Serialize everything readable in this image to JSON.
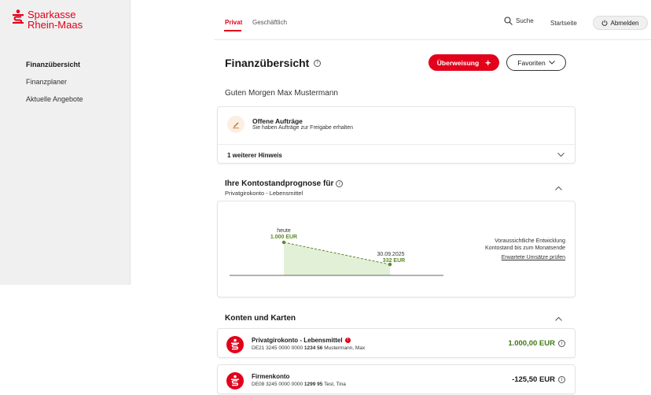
{
  "brand": {
    "name_line1": "Sparkasse",
    "name_line2": "Rhein-Maas",
    "color": "#e2001a"
  },
  "sidebar": {
    "items": [
      {
        "label": "Finanzübersicht",
        "active": true
      },
      {
        "label": "Finanzplaner",
        "active": false
      },
      {
        "label": "Aktuelle Angebote",
        "active": false
      }
    ]
  },
  "topbar": {
    "segments": [
      "Privat",
      "Geschäftlich"
    ],
    "search_label": "Suche",
    "home_label": "Startseite",
    "logout_label": "Abmelden"
  },
  "page": {
    "title": "Finanzübersicht",
    "transfer_label": "Überweisung",
    "favorites_label": "Favoriten",
    "greeting": "Guten Morgen Max Mustermann"
  },
  "orders": {
    "title": "Offene Aufträge",
    "subtitle": "Sie haben Aufträge zur Freigabe erhalten",
    "hint": "1 weiterer Hinweis"
  },
  "forecast": {
    "title": "Ihre Kontostandprognose für",
    "account": "Privatgirokonto - Lebensmittel",
    "start_label": "heute",
    "start_value": "1.000 EUR",
    "end_label": "30.09.2025",
    "end_value": "332 EUR",
    "desc_line1": "Voraussichtliche Entwicklung",
    "desc_line2": "Kontostand bis zum Monatsende",
    "link": "Erwartete Umsätze prüfen",
    "line_color": "#5a8a2a",
    "fill_color": "#e3f0d8"
  },
  "chart_data": {
    "type": "area",
    "x": [
      "heute",
      "30.09.2025"
    ],
    "values": [
      1000,
      332
    ],
    "unit": "EUR"
  },
  "accounts": {
    "title": "Konten und Karten",
    "items": [
      {
        "name": "Privatgirokonto - Lebensmittel",
        "iban_prefix": "DE21 3245 0000 0000",
        "iban_bold": "1234 56",
        "holder": "Mustermann, Max",
        "amount": "1.000,00 EUR",
        "amount_color": "#3f7a1a"
      },
      {
        "name": "Firmenkonto",
        "iban_prefix": "DE08 3245 0000 0000",
        "iban_bold": "1299 95",
        "holder": "Test, Tina",
        "amount": "-125,50 EUR",
        "amount_color": "#1a1a1a"
      }
    ]
  }
}
